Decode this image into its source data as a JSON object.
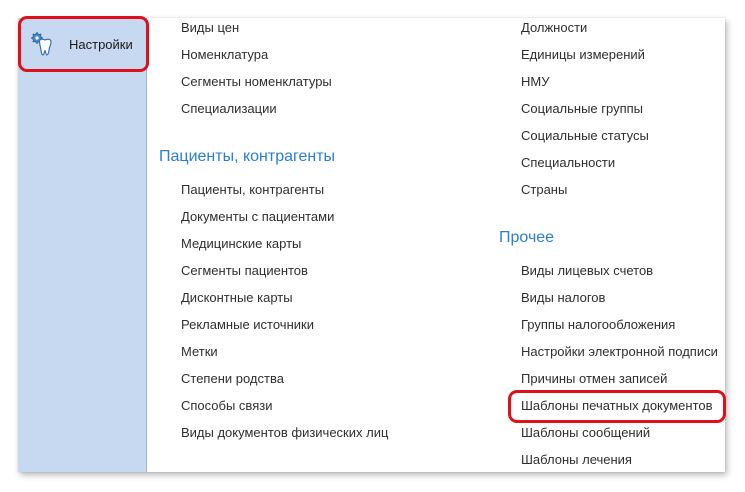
{
  "sidebar": {
    "items": [
      {
        "label": "Настройки",
        "icon": "tooth-gear-icon"
      }
    ]
  },
  "column1": {
    "top_links": [
      "Виды цен",
      "Номенклатура",
      "Сегменты номенклатуры",
      "Специализации"
    ],
    "section": {
      "title": "Пациенты, контрагенты",
      "links": [
        "Пациенты, контрагенты",
        "Документы с пациентами",
        "Медицинские карты",
        "Сегменты пациентов",
        "Дисконтные карты",
        "Рекламные источники",
        "Метки",
        "Степени родства",
        "Способы связи",
        "Виды документов физических лиц"
      ]
    }
  },
  "column2": {
    "top_links": [
      "Должности",
      "Единицы измерений",
      "НМУ",
      "Социальные группы",
      "Социальные статусы",
      "Специальности",
      "Страны"
    ],
    "section": {
      "title": "Прочее",
      "links": [
        "Виды лицевых счетов",
        "Виды налогов",
        "Группы налогообложения",
        "Настройки электронной подписи",
        "Причины отмен записей",
        "Шаблоны печатных документов",
        "Шаблоны сообщений",
        "Шаблоны лечения"
      ]
    }
  },
  "colors": {
    "sidebar_bg": "#c6d9f1",
    "section_title": "#2a7fcf",
    "highlight": "#e0101a"
  }
}
